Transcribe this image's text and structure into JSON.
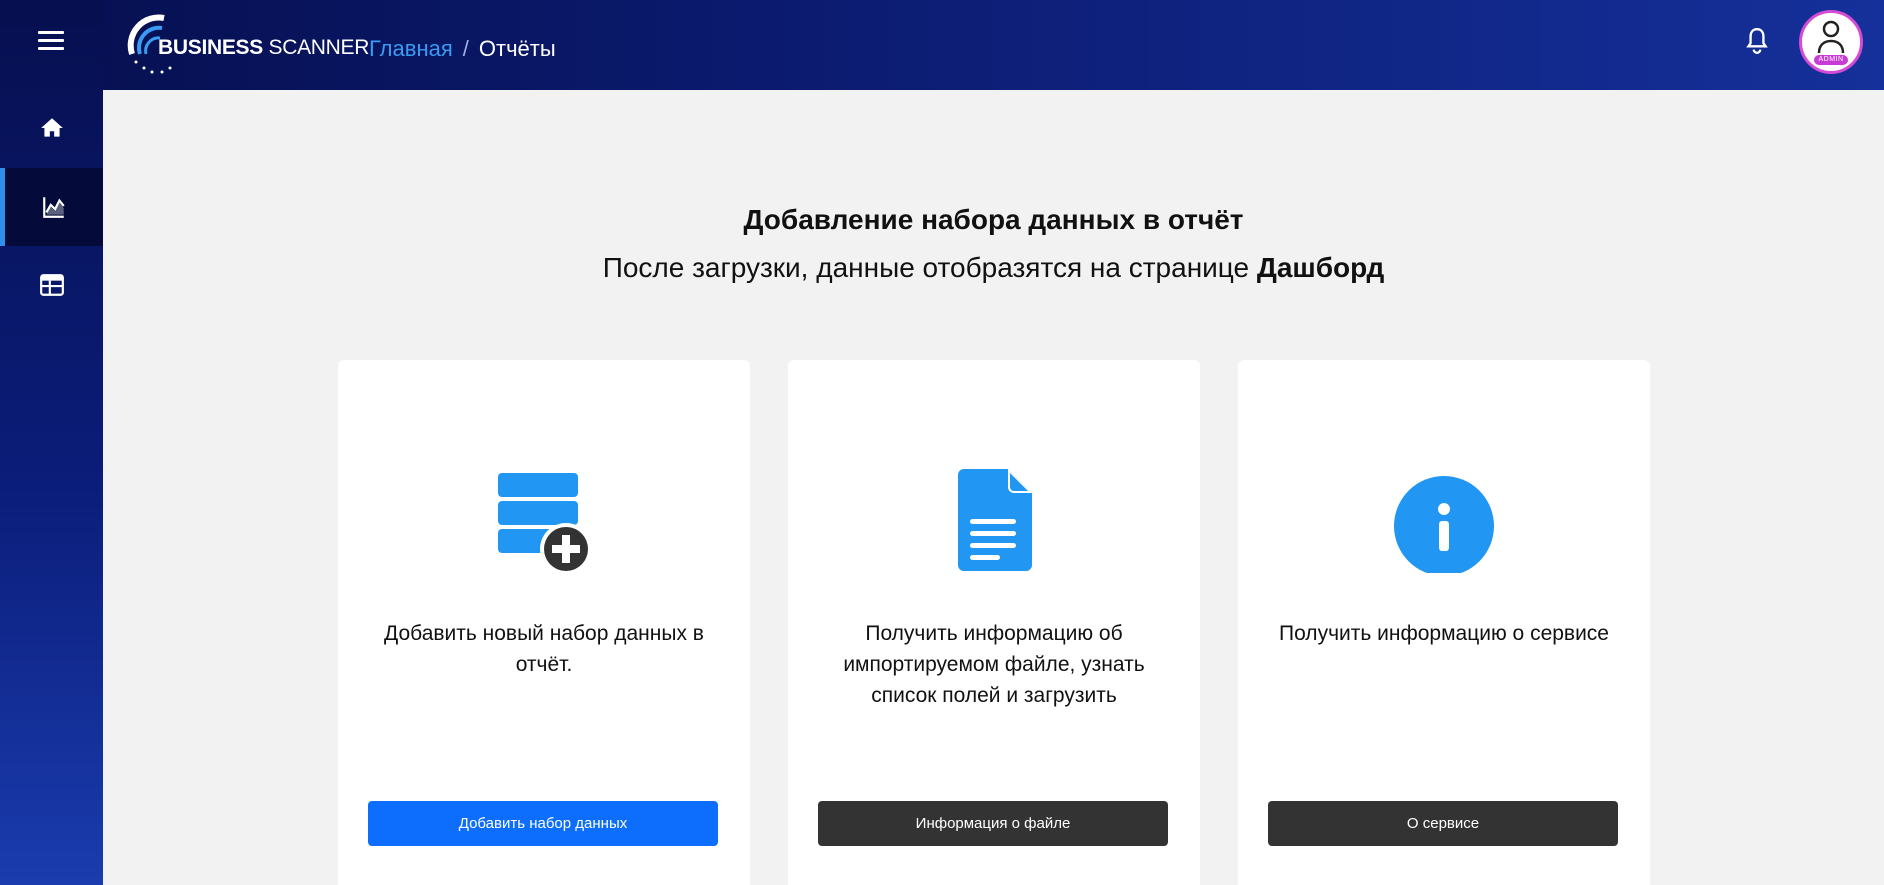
{
  "header": {
    "logo_bold": "BUSINESS",
    "logo_light": "SCANNER",
    "breadcrumb": {
      "home": "Главная",
      "separator": "/",
      "current": "Отчёты"
    },
    "avatar_badge": "ADMIN"
  },
  "sidebar": {
    "items": [
      {
        "icon": "home-icon",
        "active": false
      },
      {
        "icon": "chart-icon",
        "active": true
      },
      {
        "icon": "table-icon",
        "active": false
      }
    ]
  },
  "main": {
    "title": "Добавление набора данных в отчёт",
    "subtitle_prefix": "После загрузки, данные отобразятся на странице",
    "subtitle_bold": "Дашборд",
    "cards": [
      {
        "icon": "database-add-icon",
        "text": "Добавить новый набор данных в отчёт.",
        "button": "Добавить набор данных"
      },
      {
        "icon": "document-icon",
        "text": "Получить информацию об импортируемом файле, узнать список полей и загрузить",
        "button": "Информация о файле"
      },
      {
        "icon": "info-icon",
        "text": "Получить информацию о сервисе",
        "button": "О сервисе"
      }
    ]
  },
  "colors": {
    "accent_blue": "#2196f3",
    "primary_button": "#0d6efd",
    "dark_button": "#333333",
    "breadcrumb_link": "#3a9bf2",
    "avatar_ring": "#d44bd6"
  }
}
